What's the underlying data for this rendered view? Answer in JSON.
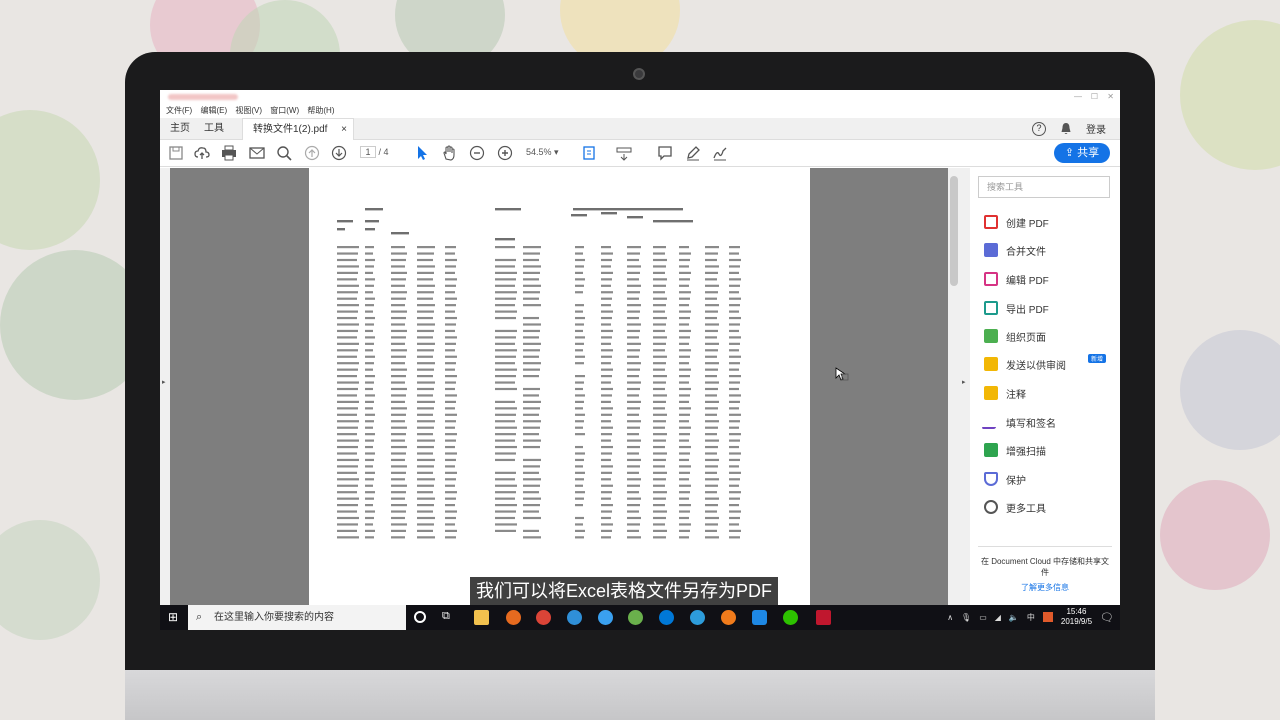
{
  "menu": [
    "文件(F)",
    "编辑(E)",
    "视图(V)",
    "窗口(W)",
    "帮助(H)"
  ],
  "tabs": {
    "home": "主页",
    "tools": "工具",
    "file": "转换文件1(2).pdf",
    "close": "×"
  },
  "header_right": {
    "login": "登录",
    "help": "?"
  },
  "toolbar": {
    "page_current": "1",
    "page_total": "/ 4",
    "zoom": "54.5%",
    "share": "共享"
  },
  "right_panel": {
    "search_placeholder": "搜索工具",
    "items": [
      "创建 PDF",
      "合并文件",
      "编辑 PDF",
      "导出 PDF",
      "组织页面",
      "发送以供审阅",
      "注释",
      "填写和签名",
      "增强扫描",
      "保护",
      "更多工具"
    ],
    "new_badge": "新增",
    "footer": "在 Document Cloud 中存储和共享文件",
    "link": "了解更多信息"
  },
  "colors": {
    "accent": "#1473e6",
    "pdf_red": "#e03131",
    "taskbar": "#101015"
  },
  "subtitle": "我们可以将Excel表格文件另存为PDF",
  "taskbar": {
    "search": "在这里输入你要搜索的内容",
    "time": "15:46",
    "date": "2019/9/5",
    "ime": "中"
  }
}
